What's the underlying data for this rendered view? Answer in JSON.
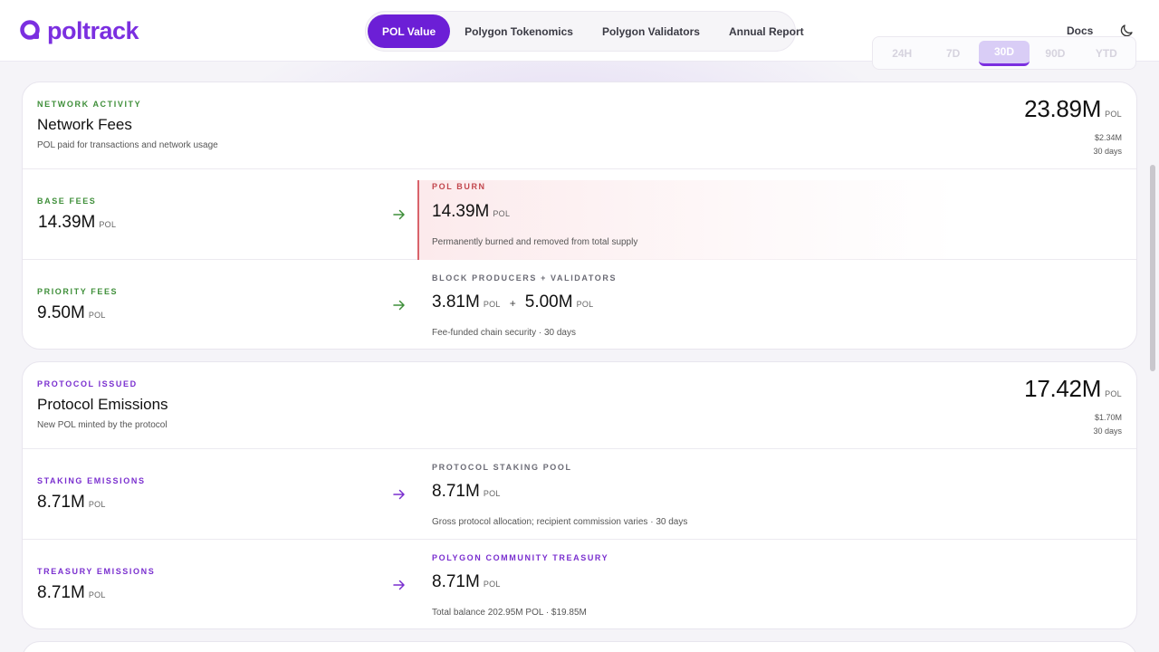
{
  "brand": {
    "name": "poltrack",
    "color": "#7b2fe0"
  },
  "nav": {
    "tabs": [
      {
        "label": "POL Value",
        "active": true
      },
      {
        "label": "Polygon Tokenomics",
        "active": false
      },
      {
        "label": "Polygon Validators",
        "active": false
      },
      {
        "label": "Annual Report",
        "active": false
      }
    ],
    "docs_label": "Docs",
    "theme_icon": "moon-icon"
  },
  "period": {
    "options": [
      "24H",
      "7D",
      "30D",
      "90D",
      "YTD"
    ],
    "selected": "30D"
  },
  "network_fees": {
    "eyebrow": "NETWORK ACTIVITY",
    "title": "Network Fees",
    "subtitle": "POL paid for transactions and network usage",
    "total": "23.89M",
    "unit": "POL",
    "usd": "$2.34M",
    "period": "30 days",
    "rows": {
      "base": {
        "label": "BASE FEES",
        "value": "14.39M",
        "unit": "POL",
        "dest_label": "POL BURN",
        "dest_value": "14.39M",
        "dest_unit": "POL",
        "dest_desc": "Permanently burned and removed from total supply"
      },
      "priority": {
        "label": "PRIORITY FEES",
        "value": "9.50M",
        "unit": "POL",
        "dest_label": "BLOCK PRODUCERS + VALIDATORS",
        "dest_value_a": "3.81M",
        "dest_unit_a": "POL",
        "plus": "+",
        "dest_value_b": "5.00M",
        "dest_unit_b": "POL",
        "dest_desc": "Fee-funded chain security · 30 days"
      }
    }
  },
  "emissions": {
    "eyebrow": "PROTOCOL ISSUED",
    "title": "Protocol Emissions",
    "subtitle": "New POL minted by the protocol",
    "total": "17.42M",
    "unit": "POL",
    "usd": "$1.70M",
    "period": "30 days",
    "rows": {
      "staking": {
        "label": "STAKING EMISSIONS",
        "value": "8.71M",
        "unit": "POL",
        "dest_label": "PROTOCOL STAKING POOL",
        "dest_value": "8.71M",
        "dest_unit": "POL",
        "dest_desc": "Gross protocol allocation; recipient commission varies · 30 days"
      },
      "treasury": {
        "label": "TREASURY EMISSIONS",
        "value": "8.71M",
        "unit": "POL",
        "dest_label": "POLYGON COMMUNITY TREASURY",
        "dest_value": "8.71M",
        "dest_unit": "POL",
        "dest_desc": "Total balance 202.95M POL · $19.85M"
      }
    }
  },
  "colors": {
    "green": "#3f8f3a",
    "purple": "#7a2fcf",
    "burn_red": "#c2464d",
    "active_tab": "#6c1fd6"
  }
}
